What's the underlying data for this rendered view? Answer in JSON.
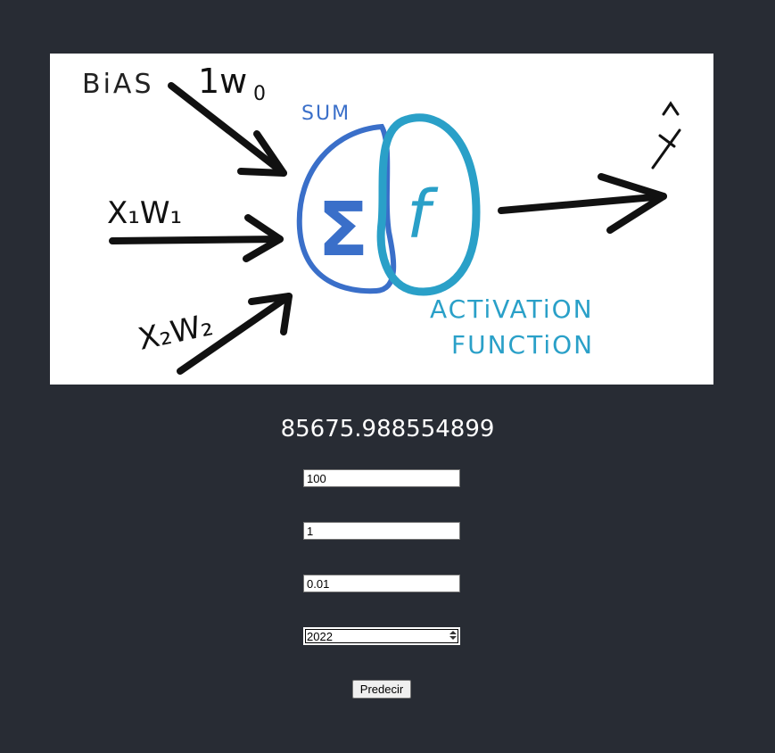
{
  "diagram": {
    "bias_label": "BiAS",
    "w0_label": "1w",
    "w0_sub": "0",
    "x1w1_label": "X₁W₁",
    "x2w2_label": "X₂W₂",
    "sum_label": "SUM",
    "sigma": "Σ",
    "f": "f",
    "yhat": "ŷ",
    "activation_line1": "ACTiVATiON",
    "activation_line2": "FUNCTiON"
  },
  "result": "85675.988554899",
  "inputs": [
    {
      "value": "100"
    },
    {
      "value": "1"
    },
    {
      "value": "0.01"
    },
    {
      "value": "2022"
    }
  ],
  "predict_button": "Predecir"
}
